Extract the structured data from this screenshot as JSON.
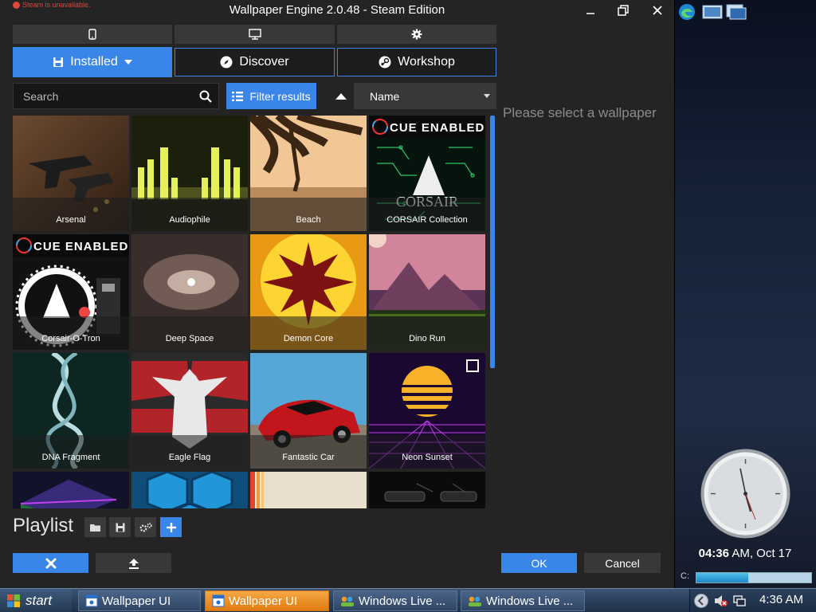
{
  "window": {
    "title": "Wallpaper Engine 2.0.48 - Steam Edition",
    "steam_warning": "Steam is unavailable."
  },
  "device_tabs": [
    {
      "icon": "phone-icon"
    },
    {
      "icon": "monitor-icon"
    },
    {
      "icon": "gear-icon"
    }
  ],
  "tabs": [
    {
      "label": "Installed",
      "icon": "save-disk-icon",
      "active": true
    },
    {
      "label": "Discover",
      "icon": "compass-icon",
      "active": false
    },
    {
      "label": "Workshop",
      "icon": "steam-icon",
      "active": false
    }
  ],
  "search": {
    "placeholder": "Search",
    "value": ""
  },
  "filter": {
    "label": "Filter results"
  },
  "sort": {
    "selected": "Name"
  },
  "wallpapers": [
    {
      "title": "Arsenal",
      "art": "arsenal"
    },
    {
      "title": "Audiophile",
      "art": "audiophile"
    },
    {
      "title": "Beach",
      "art": "beach"
    },
    {
      "title": "CORSAIR Collection",
      "art": "corsair"
    },
    {
      "title": "Corsair-O-Tron",
      "art": "corsair_otron"
    },
    {
      "title": "Deep Space",
      "art": "deepspace"
    },
    {
      "title": "Demon Core",
      "art": "demoncore"
    },
    {
      "title": "Dino Run",
      "art": "dinorun"
    },
    {
      "title": "DNA Fragment",
      "art": "dna"
    },
    {
      "title": "Eagle Flag",
      "art": "eagle"
    },
    {
      "title": "Fantastic Car",
      "art": "car"
    },
    {
      "title": "Neon Sunset",
      "art": "neon",
      "selected": true
    },
    {
      "title": "",
      "art": "row4a"
    },
    {
      "title": "",
      "art": "row4b"
    },
    {
      "title": "",
      "art": "row4c"
    },
    {
      "title": "",
      "art": "row4d"
    }
  ],
  "cue_badge": {
    "text": "CUE ENABLED",
    "brand": "CORSAIR"
  },
  "preview": {
    "message": "Please select a wallpaper"
  },
  "playlist": {
    "title": "Playlist"
  },
  "buttons": {
    "ok": "OK",
    "cancel": "Cancel"
  },
  "sidebar": {
    "time": "04:36",
    "date_suffix": " AM, Oct 17",
    "drive_label": "C:",
    "drive_used": 0.45
  },
  "taskbar": {
    "start": "start",
    "tasks": [
      {
        "label": "Wallpaper UI",
        "active": false
      },
      {
        "label": "Wallpaper UI",
        "active": true
      },
      {
        "label": "Windows Live ...",
        "active": false
      },
      {
        "label": "Windows Live ...",
        "active": false
      }
    ],
    "clock": "4:36 AM"
  },
  "colors": {
    "accent": "#3a86e8",
    "window_bg": "#242424",
    "taskbar_active": "#f0951f"
  }
}
